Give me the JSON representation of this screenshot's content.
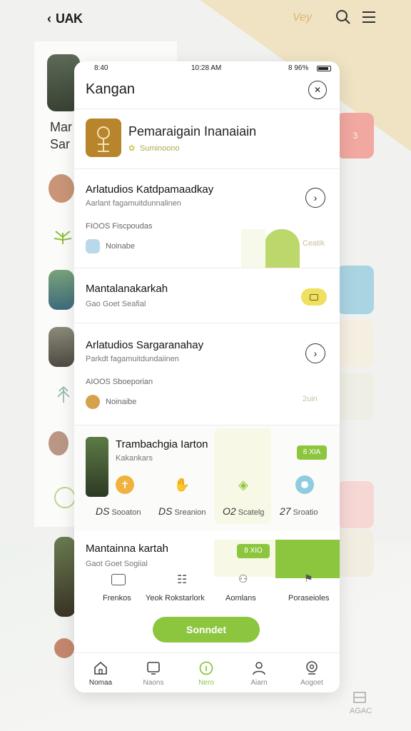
{
  "background": {
    "title": "UAK",
    "logo": "Vey",
    "left_text_1": "Mar",
    "left_text_2": "Sar",
    "right_cards": [
      "3",
      "",
      "",
      "",
      "",
      "",
      ""
    ],
    "bottom_right_label": "AGAC"
  },
  "status_bar": {
    "left": "8:40",
    "center": "10:28 AM",
    "right": "8 96%"
  },
  "app": {
    "title": "Kangan",
    "close_icon": "close-icon"
  },
  "header_card": {
    "title": "Pemaraigain Inanaiain",
    "subtitle": "Suminoono"
  },
  "sections": [
    {
      "title": "Arlatudios Katdpamaadkay",
      "subtitle": "Aarlant fagamuitdunnalinen",
      "meta": "FIOOS Fiscpoudas",
      "mini_label": "Noinabe",
      "side_note": "Ceatik"
    },
    {
      "title": "Mantalanakarkah",
      "subtitle": "Gao Goet Seafial",
      "badge": ""
    },
    {
      "title": "Arlatudios Sargaranahay",
      "subtitle": "Parkdt fagamuitdundaiinen",
      "meta": "AIOOS Sboeporian",
      "mini_label": "Noinaibe",
      "side_note": "2uin"
    },
    {
      "title": "Trambachgia Iarton",
      "subtitle": "Kakankars",
      "badge": "8 XIA",
      "items": [
        {
          "num": "DS",
          "label": "Sooaton"
        },
        {
          "num": "DS",
          "label": "Sreanion"
        },
        {
          "num": "O2",
          "label": "Scatelg"
        },
        {
          "num": "27",
          "label": "Sroatio"
        }
      ]
    },
    {
      "title": "Mantainna kartah",
      "subtitle": "Gaot Goet Sogiial",
      "badge": "8 XIO",
      "shortcuts": [
        {
          "label": "Frenkos"
        },
        {
          "label": "Yeok Rokstarlork"
        },
        {
          "label": "Aomlans"
        },
        {
          "label": "Poraseioles"
        }
      ]
    }
  ],
  "primary_button": "Sonndet",
  "tabs": [
    {
      "label": "Nomaa",
      "icon": "home-icon"
    },
    {
      "label": "Naons",
      "icon": "tablet-icon"
    },
    {
      "label": "Nero",
      "icon": "info-icon"
    },
    {
      "label": "Aiarn",
      "icon": "user-icon"
    },
    {
      "label": "Aogoet",
      "icon": "settings-icon"
    }
  ],
  "colors": {
    "accent_green": "#8cc63f",
    "accent_yellow": "#e8dc5a",
    "salmon": "#f0a8a0",
    "sky": "#a9d4e2",
    "sand": "#efe3c4"
  }
}
